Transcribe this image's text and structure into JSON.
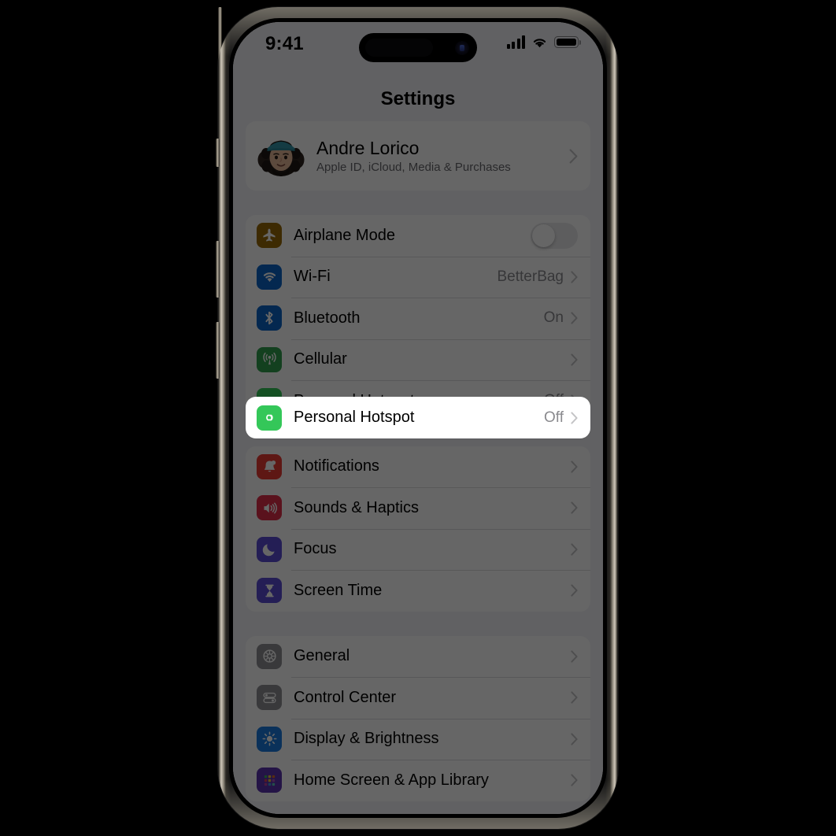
{
  "statusbar": {
    "time": "9:41",
    "signal_icon": "cellular-bars-icon",
    "signal_bars": 4,
    "wifi_icon": "wifi-icon",
    "battery_icon": "battery-full-icon",
    "battery_level": 100
  },
  "nav": {
    "title": "Settings"
  },
  "account": {
    "name": "Andre Lorico",
    "subtitle": "Apple ID, iCloud, Media & Purchases",
    "avatar_icon": "memoji-avatar",
    "chevron_icon": "chevron-right-icon"
  },
  "groups": [
    {
      "name": "connectivity",
      "rows": [
        {
          "label": "Airplane Mode",
          "icon": "airplane-icon",
          "icon_color": "#9a6a05",
          "control": "toggle",
          "toggle_on": false,
          "value": ""
        },
        {
          "label": "Wi-Fi",
          "icon": "wifi-icon",
          "icon_color": "#0b64c8",
          "control": "chevron",
          "value": "BetterBag"
        },
        {
          "label": "Bluetooth",
          "icon": "bluetooth-icon",
          "icon_color": "#0b64c8",
          "control": "chevron",
          "value": "On"
        },
        {
          "label": "Cellular",
          "icon": "cellular-antenna-icon",
          "icon_color": "#30a14e",
          "control": "chevron",
          "value": ""
        },
        {
          "label": "Personal Hotspot",
          "icon": "personal-hotspot-icon",
          "icon_color": "#34c759",
          "control": "chevron",
          "value": "Off",
          "highlighted": true
        }
      ]
    },
    {
      "name": "alerts",
      "rows": [
        {
          "label": "Notifications",
          "icon": "bell-icon",
          "icon_color": "#ec3a34",
          "control": "chevron",
          "value": ""
        },
        {
          "label": "Sounds & Haptics",
          "icon": "speaker-wave-icon",
          "icon_color": "#e02d4a",
          "control": "chevron",
          "value": ""
        },
        {
          "label": "Focus",
          "icon": "moon-icon",
          "icon_color": "#5a4bd4",
          "control": "chevron",
          "value": ""
        },
        {
          "label": "Screen Time",
          "icon": "hourglass-icon",
          "icon_color": "#5a4bd4",
          "control": "chevron",
          "value": ""
        }
      ]
    },
    {
      "name": "system",
      "rows": [
        {
          "label": "General",
          "icon": "gear-icon",
          "icon_color": "#8e8e93",
          "control": "chevron",
          "value": ""
        },
        {
          "label": "Control Center",
          "icon": "control-center-icon",
          "icon_color": "#8e8e93",
          "control": "chevron",
          "value": ""
        },
        {
          "label": "Display & Brightness",
          "icon": "brightness-sun-icon",
          "icon_color": "#1a7ae0",
          "control": "chevron",
          "value": ""
        },
        {
          "label": "Home Screen & App Library",
          "icon": "app-grid-icon",
          "icon_color": "#5a33b0",
          "control": "chevron",
          "value": ""
        }
      ]
    }
  ],
  "spotlight": {
    "target_label": "Personal Hotspot",
    "target_value": "Off",
    "icon": "personal-hotspot-icon",
    "icon_color": "#34c759",
    "chevron_icon": "chevron-right-icon"
  },
  "colors": {
    "screen_background": "#f2f2f7",
    "card_background": "#ffffff",
    "separator": "#c6c6c8",
    "secondary_text": "#8a8a8e",
    "dim_overlay": "rgba(0,0,0,0.60)",
    "device_frame": "#0a0a0a"
  }
}
